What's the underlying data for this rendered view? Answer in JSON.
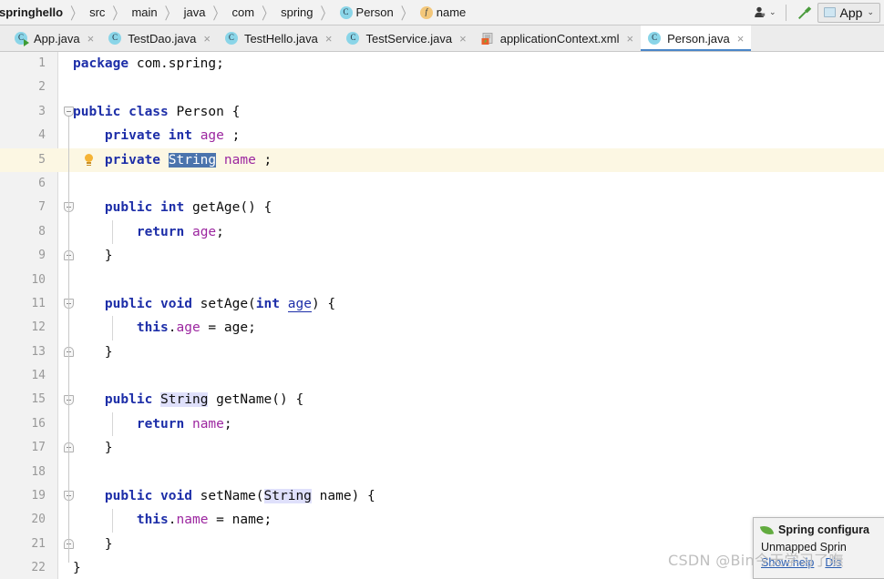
{
  "navbar": {
    "breadcrumbs": [
      {
        "label": "springhello",
        "icon": "none",
        "bold": true
      },
      {
        "label": "src",
        "icon": "none",
        "bold": false
      },
      {
        "label": "main",
        "icon": "none",
        "bold": false
      },
      {
        "label": "java",
        "icon": "none",
        "bold": false
      },
      {
        "label": "com",
        "icon": "none",
        "bold": false
      },
      {
        "label": "spring",
        "icon": "none",
        "bold": false
      },
      {
        "label": "Person",
        "icon": "class-icon",
        "icon_glyph": "C",
        "bold": false
      },
      {
        "label": "name",
        "icon": "field-icon",
        "icon_glyph": "f",
        "bold": false
      }
    ],
    "separator": "〉",
    "user_icon": "user-avatar-icon",
    "user_caret": "⌄",
    "build_icon": "build-hammer-icon",
    "run_config": {
      "label": "App",
      "icon": "run-configuration-icon",
      "caret": "⌄"
    }
  },
  "tabs": [
    {
      "label": "App.java",
      "icon": "java-class-runnable-icon",
      "icon_glyph": "C",
      "close": "×",
      "active": false
    },
    {
      "label": "TestDao.java",
      "icon": "java-class-icon",
      "icon_glyph": "C",
      "close": "×",
      "active": false
    },
    {
      "label": "TestHello.java",
      "icon": "java-class-icon",
      "icon_glyph": "C",
      "close": "×",
      "active": false
    },
    {
      "label": "TestService.java",
      "icon": "java-class-icon",
      "icon_glyph": "C",
      "close": "×",
      "active": false
    },
    {
      "label": "applicationContext.xml",
      "icon": "spring-xml-icon",
      "icon_glyph": "",
      "close": "×",
      "active": false
    },
    {
      "label": "Person.java",
      "icon": "java-class-icon",
      "icon_glyph": "C",
      "close": "×",
      "active": true
    }
  ],
  "editor": {
    "caret_line": 5,
    "lines": [
      {
        "n": "1",
        "html": "<span class=\"kw\">package</span> com.spring;"
      },
      {
        "n": "2",
        "html": ""
      },
      {
        "n": "3",
        "html": "<span class=\"kw\">public class</span> Person {"
      },
      {
        "n": "4",
        "html": "    <span class=\"kw\">private int</span> <span class=\"fieldn\">age</span> ;"
      },
      {
        "n": "5",
        "html": "    <span class=\"kw\">private</span> <span class=\"sel\">String</span> <span class=\"fieldn\">name</span> ;"
      },
      {
        "n": "6",
        "html": ""
      },
      {
        "n": "7",
        "html": "    <span class=\"kw\">public int</span> getAge() {"
      },
      {
        "n": "8",
        "html": "        <span class=\"kw\">return</span> <span class=\"fieldn\">age</span>;"
      },
      {
        "n": "9",
        "html": "    }"
      },
      {
        "n": "10",
        "html": ""
      },
      {
        "n": "11",
        "html": "    <span class=\"kw\">public void</span> setAge(<span class=\"kw\">int</span> <span class=\"param\">age</span>) {"
      },
      {
        "n": "12",
        "html": "        <span class=\"kw\">this</span>.<span class=\"fieldn\">age</span> = age;"
      },
      {
        "n": "13",
        "html": "    }"
      },
      {
        "n": "14",
        "html": ""
      },
      {
        "n": "15",
        "html": "    <span class=\"kw\">public</span> <span class=\"usage\">String</span> getName() {"
      },
      {
        "n": "16",
        "html": "        <span class=\"kw\">return</span> <span class=\"fieldn\">name</span>;"
      },
      {
        "n": "17",
        "html": "    }"
      },
      {
        "n": "18",
        "html": ""
      },
      {
        "n": "19",
        "html": "    <span class=\"kw\">public void</span> setName(<span class=\"usage\">String</span> name) {"
      },
      {
        "n": "20",
        "html": "        <span class=\"kw\">this</span>.<span class=\"fieldn\">name</span> = name;"
      },
      {
        "n": "21",
        "html": "    }"
      },
      {
        "n": "22",
        "html": "}"
      }
    ],
    "plain_text": "package com.spring;\n\npublic class Person {\n    private int age ;\n    private String name ;\n\n    public int getAge() {\n        return age;\n    }\n\n    public void setAge(int age) {\n        this.age = age;\n    }\n\n    public String getName() {\n        return name;\n    }\n\n    public void setName(String name) {\n        this.name = name;\n    }\n}",
    "intention_bulb": "intention-lightbulb-icon",
    "folds": [
      {
        "line": 3,
        "state": "open"
      },
      {
        "line": 7,
        "state": "open"
      },
      {
        "line": 9,
        "state": "close"
      },
      {
        "line": 11,
        "state": "open"
      },
      {
        "line": 13,
        "state": "close"
      },
      {
        "line": 15,
        "state": "open"
      },
      {
        "line": 17,
        "state": "close"
      },
      {
        "line": 19,
        "state": "open"
      },
      {
        "line": 21,
        "state": "close"
      }
    ]
  },
  "popup": {
    "icon": "spring-leaf-icon",
    "title": "Spring configura",
    "body": "Unmapped Sprin",
    "links": [
      "Show help",
      "Dis"
    ]
  },
  "watermark": {
    "text": "CSDN @Bin今天学习了嘸"
  },
  "colors": {
    "keyword": "#1d2ea8",
    "field": "#9c27a0",
    "selection": "#4b74ad",
    "usage_highlight": "#dfe0fb",
    "caret_line": "#fcf7e3",
    "gutter": "#f2f2f2",
    "tab_active_underline": "#4a86c8",
    "spring_green": "#62ab3f",
    "link": "#2a5db0"
  }
}
